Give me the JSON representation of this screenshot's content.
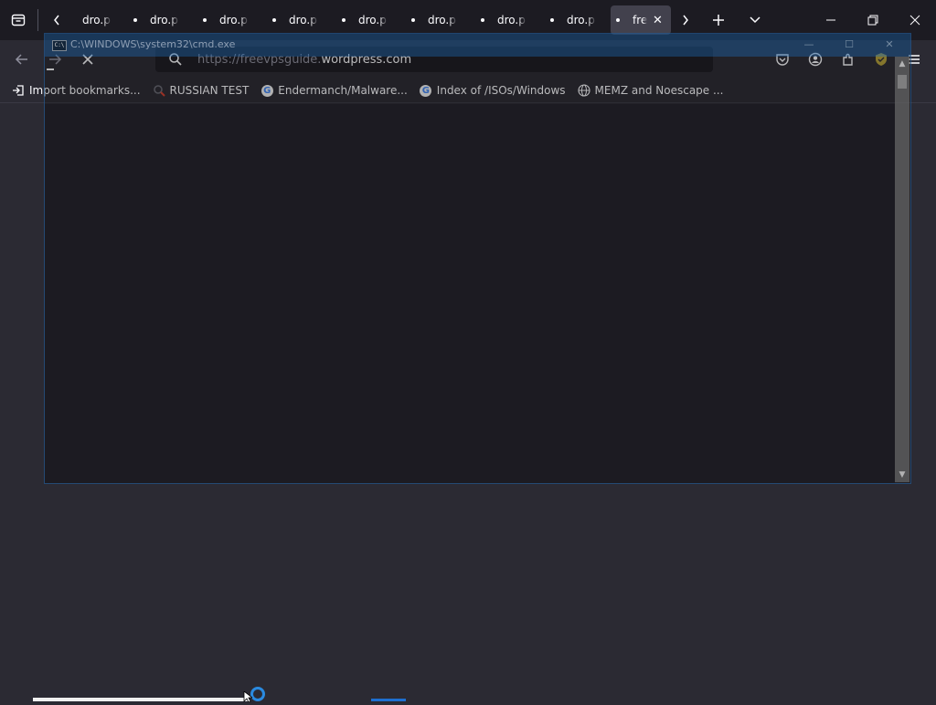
{
  "tabs": [
    {
      "title": "dro.p",
      "active": false
    },
    {
      "title": "dro.p",
      "active": false
    },
    {
      "title": "dro.p",
      "active": false
    },
    {
      "title": "dro.p",
      "active": false
    },
    {
      "title": "dro.p",
      "active": false
    },
    {
      "title": "dro.p",
      "active": false
    },
    {
      "title": "dro.p",
      "active": false
    },
    {
      "title": "dro.p",
      "active": false
    },
    {
      "title": "fre",
      "active": true
    }
  ],
  "navbar": {
    "url_prefix": "https://freevpsguide.",
    "url_domain": "wordpress.com"
  },
  "bookmarks": [
    {
      "label": "Import bookmarks...",
      "icon": "import-icon"
    },
    {
      "label": "RUSSIAN TEST",
      "icon": "search-favicon"
    },
    {
      "label": "Endermanch/Malware...",
      "icon": "google-favicon"
    },
    {
      "label": "Index of /ISOs/Windows",
      "icon": "google-favicon"
    },
    {
      "label": "MEMZ and Noescape ...",
      "icon": "globe-icon"
    }
  ],
  "cmd_window": {
    "title": "C:\\WINDOWS\\system32\\cmd.exe"
  },
  "colors": {
    "tabstrip": "#1c1b22",
    "toolbar": "#2b2a33",
    "active_tab": "#42414d",
    "cmd_title": "#1e6ebe"
  }
}
